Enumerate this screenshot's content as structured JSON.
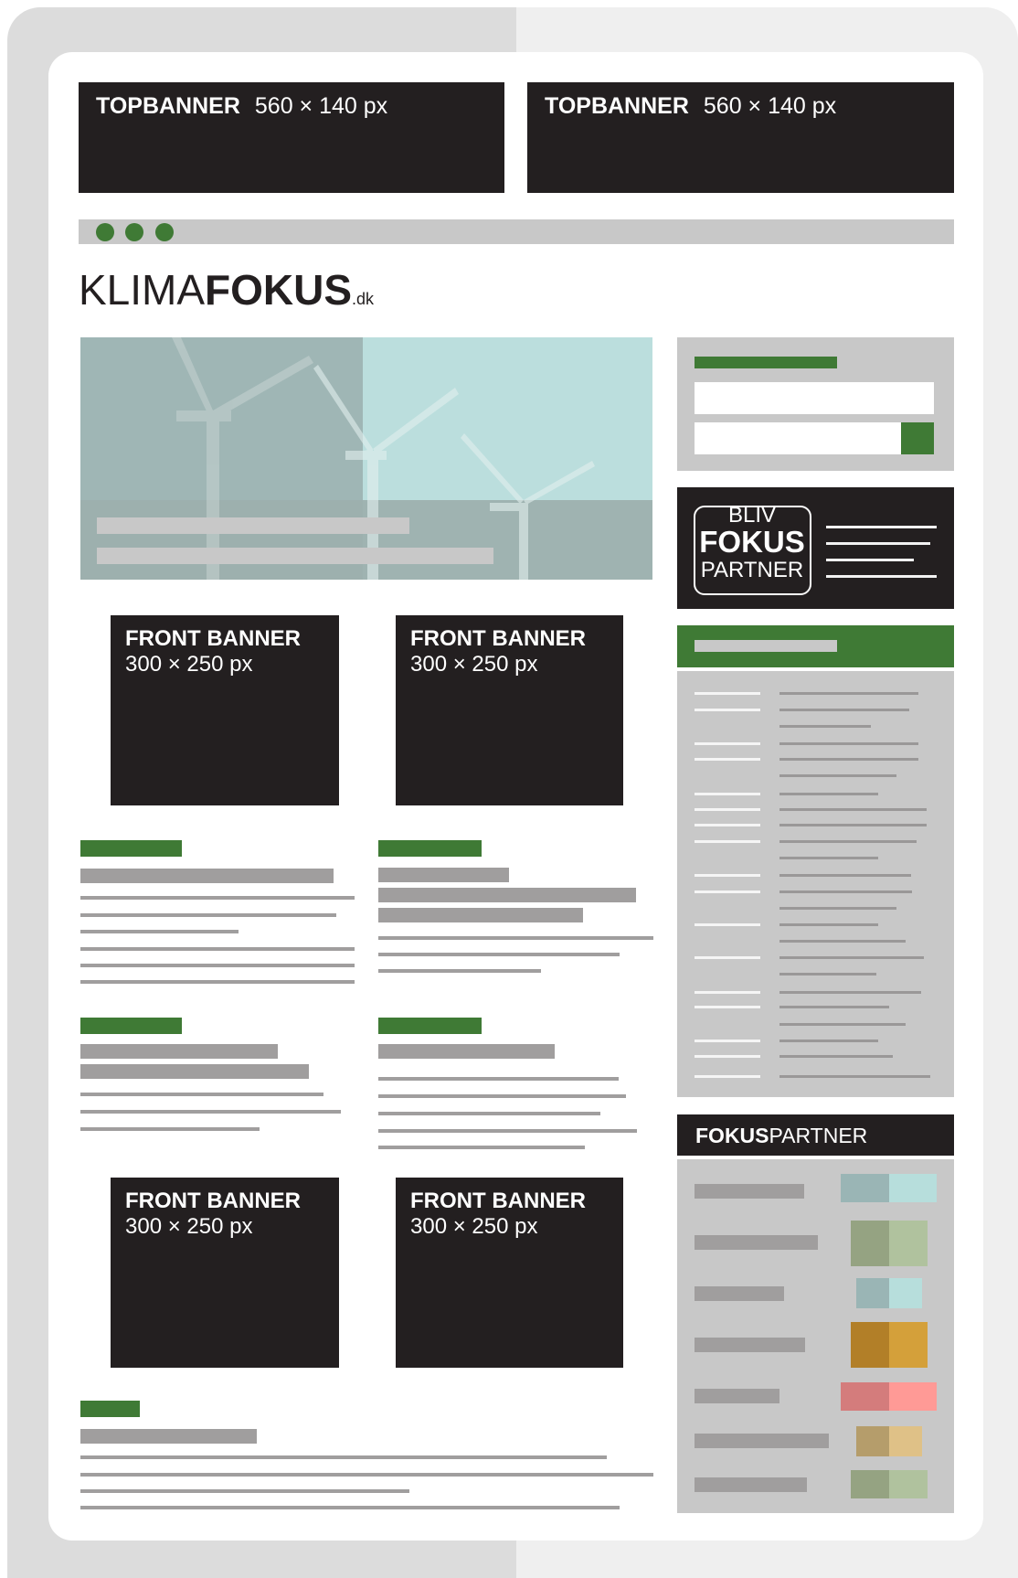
{
  "topbanners": [
    {
      "label": "TOPBANNER",
      "size": "560 × 140 px"
    },
    {
      "label": "TOPBANNER",
      "size": "560 × 140 px"
    }
  ],
  "logo": {
    "part1": "KLIMA",
    "part2": "FOKUS",
    "suffix": ".dk"
  },
  "front_banners": [
    {
      "label": "FRONT BANNER",
      "size": "300 × 250 px"
    },
    {
      "label": "FRONT BANNER",
      "size": "300 × 250 px"
    },
    {
      "label": "FRONT BANNER",
      "size": "300 × 250 px"
    },
    {
      "label": "FRONT BANNER",
      "size": "300 × 250 px"
    }
  ],
  "partner_badge": {
    "line1": "BLIV",
    "line2": "FOKUS",
    "line3": "PARTNER"
  },
  "fokuspartner_header": {
    "bold": "FOKUS",
    "light": "PARTNER"
  },
  "colors": {
    "accent": "#3f7a35",
    "banner": "#231f20",
    "placeholder": "#a09e9e",
    "panel": "#c8c8c8",
    "swatches": [
      [
        "#9ab5b5",
        "#b7dedc"
      ],
      [
        "#95a382",
        "#b0c29e"
      ],
      [
        "#9ab5b5",
        "#b7dedc"
      ],
      [
        "#b27f28",
        "#d4a03a"
      ],
      [
        "#d47c7c",
        "#ff9a96"
      ],
      [
        "#b59d6b",
        "#dfc187"
      ],
      [
        "#95a382",
        "#b0c29e"
      ]
    ]
  }
}
